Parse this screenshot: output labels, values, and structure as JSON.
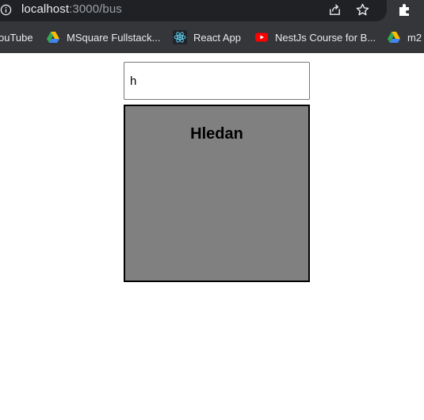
{
  "browser": {
    "url_host": "localhost",
    "url_path": ":3000/bus",
    "icons": [
      "info-icon",
      "share-icon",
      "star-icon",
      "extensions-icon"
    ]
  },
  "bookmarks": [
    {
      "label": "ouTube",
      "icon": "youtube-icon"
    },
    {
      "label": "MSquare Fullstack...",
      "icon": "google-drive-icon"
    },
    {
      "label": "React App",
      "icon": "react-icon"
    },
    {
      "label": "NestJs Course for B...",
      "icon": "youtube-icon"
    },
    {
      "label": "m2",
      "icon": "google-drive-icon"
    }
  ],
  "search": {
    "value": "h"
  },
  "card": {
    "title": "Hledan",
    "background": "#808080"
  }
}
